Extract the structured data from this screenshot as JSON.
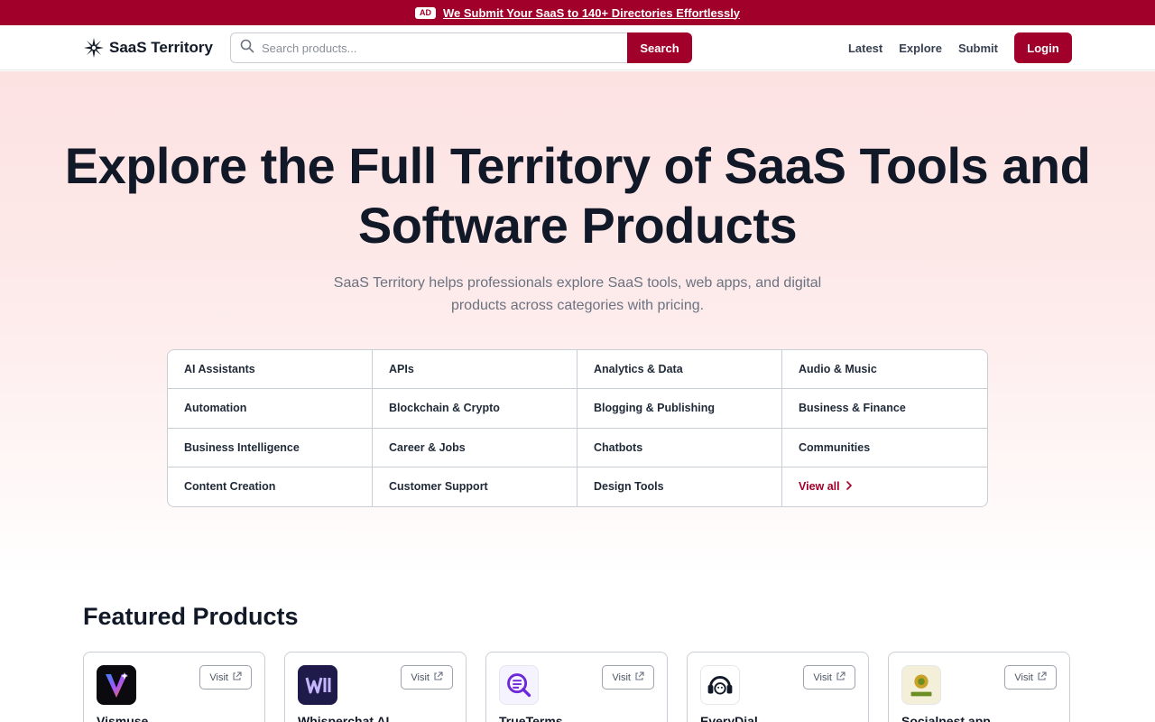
{
  "ad_bar": {
    "badge": "AD",
    "text": "We Submit Your SaaS to 140+ Directories Effortlessly"
  },
  "header": {
    "brand": "SaaS Territory",
    "search_placeholder": "Search products...",
    "search_button": "Search",
    "nav": [
      "Latest",
      "Explore",
      "Submit"
    ],
    "login": "Login"
  },
  "hero": {
    "title": "Explore the Full Territory of SaaS Tools and Software Products",
    "subtitle": "SaaS Territory helps professionals explore SaaS tools, web apps, and digital products across categories with pricing."
  },
  "categories": [
    "AI Assistants",
    "APIs",
    "Analytics & Data",
    "Audio & Music",
    "Automation",
    "Blockchain & Crypto",
    "Blogging & Publishing",
    "Business & Finance",
    "Business Intelligence",
    "Career & Jobs",
    "Chatbots",
    "Communities",
    "Content Creation",
    "Customer Support",
    "Design Tools"
  ],
  "view_all": "View all",
  "featured": {
    "title": "Featured Products",
    "visit_label": "Visit",
    "products": [
      {
        "name": "Vismuse",
        "icon": "vismuse-logo"
      },
      {
        "name": "Whisperchat AI",
        "icon": "whisperchat-logo"
      },
      {
        "name": "TrueTerms",
        "icon": "trueterms-logo"
      },
      {
        "name": "EveryDial",
        "icon": "everydial-logo"
      },
      {
        "name": "Socialnest.app",
        "icon": "socialnest-logo"
      }
    ]
  },
  "colors": {
    "brand": "#a1002a",
    "text": "#111827",
    "muted": "#6b7280"
  }
}
